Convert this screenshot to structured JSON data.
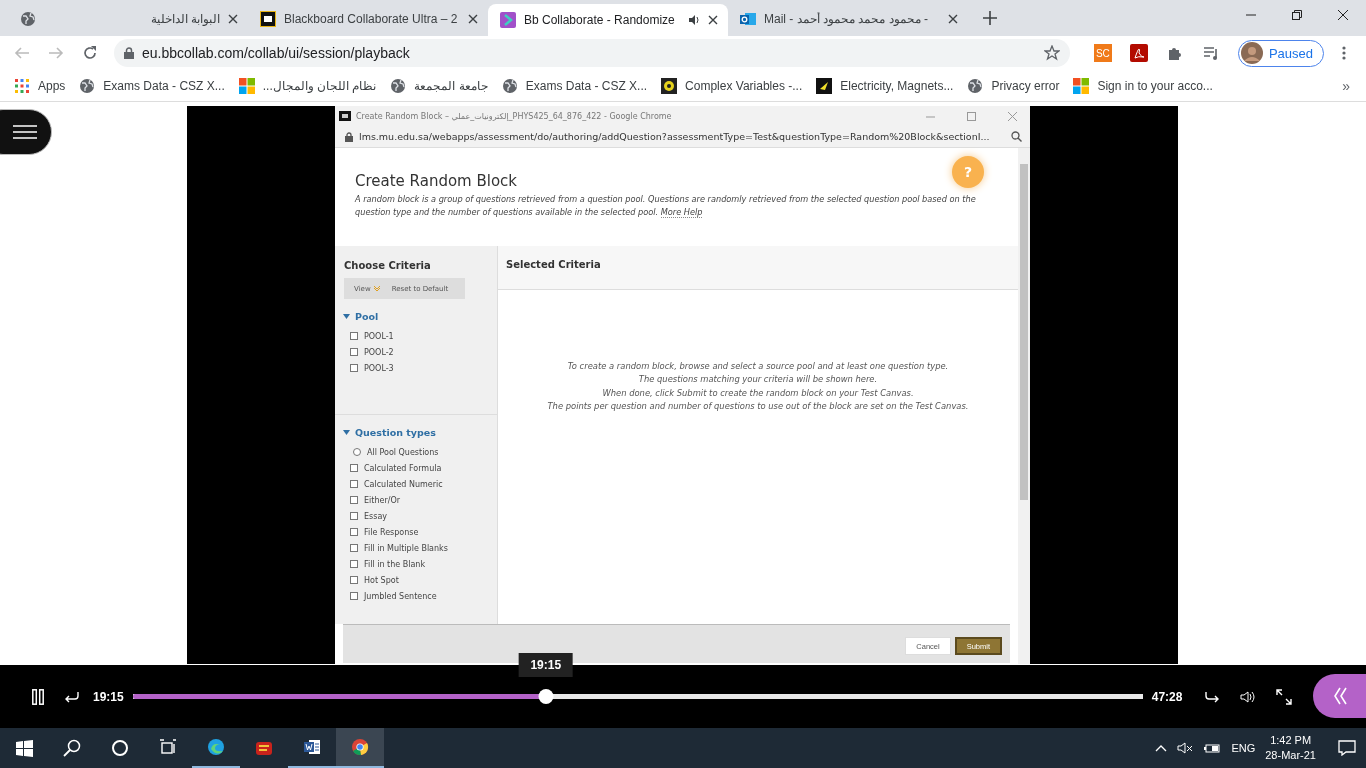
{
  "browser": {
    "tabs": [
      {
        "title": "البوابة الداخلية",
        "kind": "globe",
        "selected": false,
        "audio": false
      },
      {
        "title": "Blackboard Collaborate Ultra – 2",
        "kind": "bb",
        "selected": false,
        "audio": false
      },
      {
        "title": "Bb Collaborate - Randomize",
        "kind": "collab",
        "selected": true,
        "audio": true
      },
      {
        "title": "Mail - محمود محمد محمود أحمد - ",
        "kind": "outlook",
        "selected": false,
        "audio": false
      }
    ],
    "address": "eu.bbcollab.com/collab/ui/session/playback",
    "extensions": [
      {
        "kind": "sc",
        "label": "SC"
      },
      {
        "kind": "pdf"
      },
      {
        "kind": "puzzle"
      },
      {
        "kind": "media"
      }
    ],
    "profile": "Paused",
    "bookmarks": [
      {
        "kind": "apps",
        "title": "Apps"
      },
      {
        "kind": "globe",
        "title": "Exams Data - CSZ X..."
      },
      {
        "kind": "ms",
        "title": "نظام اللجان والمجال..."
      },
      {
        "kind": "globe",
        "title": "جامعة المجمعة"
      },
      {
        "kind": "globe",
        "title": "Exams Data - CSZ X..."
      },
      {
        "kind": "complex",
        "title": "Complex Variables -..."
      },
      {
        "kind": "phet",
        "title": "Electricity, Magnets..."
      },
      {
        "kind": "globe",
        "title": "Privacy error"
      },
      {
        "kind": "ms",
        "title": "Sign in to your acco..."
      }
    ],
    "more": "»"
  },
  "player": {
    "popup": {
      "title": "Create Random Block – إلكترونيات_عملي_PHYS425_64_876_422 - Google Chrome",
      "url": "lms.mu.edu.sa/webapps/assessment/do/authoring/addQuestion?assessmentType=Test&questionType=Random%20Block&sectionI...",
      "heading": "Create Random Block",
      "description": "A random block is a group of questions retrieved from a question pool. Questions are randomly retrieved from the selected question pool based on the question type and the number of questions available in the selected pool.",
      "help_link": "More Help",
      "help_button": "?",
      "criteria": {
        "title": "Choose Criteria",
        "view_button": "View",
        "reset_button": "Reset to Default",
        "sections": [
          {
            "title": "Pool",
            "expanded": true,
            "items": [
              {
                "label": "POOL-1",
                "kind": "checkbox",
                "checked": false
              },
              {
                "label": "POOL-2",
                "kind": "checkbox",
                "checked": false
              },
              {
                "label": "POOL-3",
                "kind": "checkbox",
                "checked": false
              }
            ]
          },
          {
            "title": "Question types",
            "expanded": true,
            "items": [
              {
                "label": "All Pool Questions",
                "kind": "radio",
                "checked": false
              },
              {
                "label": "Calculated Formula",
                "kind": "checkbox",
                "checked": false
              },
              {
                "label": "Calculated Numeric",
                "kind": "checkbox",
                "checked": false
              },
              {
                "label": "Either/Or",
                "kind": "checkbox",
                "checked": false
              },
              {
                "label": "Essay",
                "kind": "checkbox",
                "checked": false
              },
              {
                "label": "File Response",
                "kind": "checkbox",
                "checked": false
              },
              {
                "label": "Fill in Multiple Blanks",
                "kind": "checkbox",
                "checked": false
              },
              {
                "label": "Fill in the Blank",
                "kind": "checkbox",
                "checked": false
              },
              {
                "label": "Hot Spot",
                "kind": "checkbox",
                "checked": false
              },
              {
                "label": "Jumbled Sentence",
                "kind": "checkbox",
                "checked": false
              }
            ]
          }
        ]
      },
      "selected": {
        "title": "Selected Criteria",
        "instructions": [
          "To create a random block, browse and select a source pool and at least one question type.",
          "The questions matching your criteria will be shown here.",
          "When done, click Submit to create the random block on your Test Canvas.",
          "The points per question and number of questions to use out of the block are set on the Test Canvas."
        ]
      },
      "buttons": [
        {
          "label": "Cancel",
          "kind": "secondary"
        },
        {
          "label": "Submit",
          "kind": "primary"
        }
      ]
    },
    "controls": {
      "current_time": "19:15",
      "tooltip": "19:15",
      "total_time": "47:28",
      "progress": {
        "level": 0.409
      }
    }
  },
  "taskbar": {
    "apps": [
      {
        "kind": "start",
        "selected": false,
        "running": false
      },
      {
        "kind": "search",
        "selected": false,
        "running": false
      },
      {
        "kind": "cortana",
        "selected": false,
        "running": false
      },
      {
        "kind": "taskview",
        "selected": false,
        "running": false
      },
      {
        "kind": "edge",
        "selected": false,
        "running": true
      },
      {
        "kind": "en",
        "selected": false,
        "running": false
      },
      {
        "kind": "word",
        "selected": false,
        "running": true
      },
      {
        "kind": "chrome",
        "selected": true,
        "running": true
      }
    ],
    "language": "ENG",
    "time": "1:42 PM",
    "date": "28-Mar-21"
  }
}
